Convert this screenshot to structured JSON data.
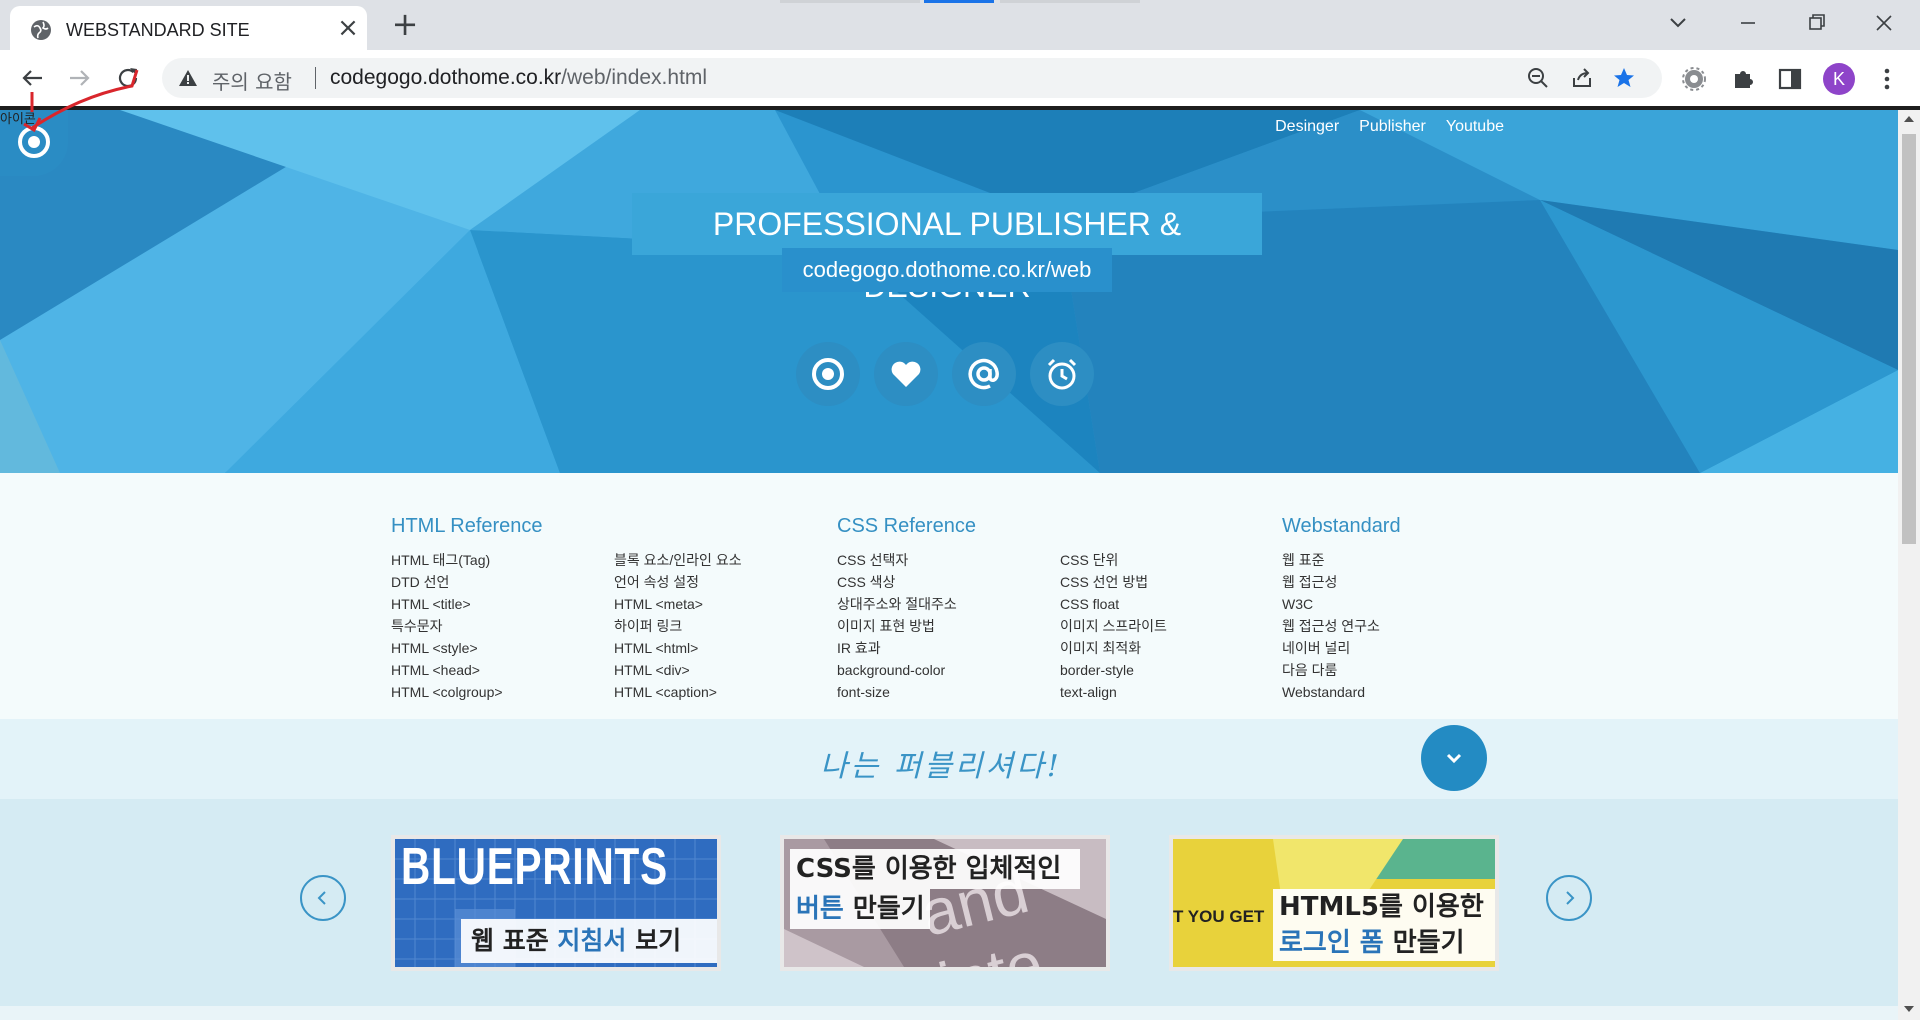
{
  "browser": {
    "tab_title": "WEBSTANDARD SITE",
    "security_warning": "주의 요함",
    "url_host": "codegogo.dothome.co.kr",
    "url_path": "/web/index.html",
    "profile_initial": "K"
  },
  "page": {
    "corner_label": "아이콘",
    "top_nav": [
      "Desinger",
      "Publisher",
      "Youtube"
    ],
    "headline": "PROFESSIONAL PUBLISHER & DESIGNER",
    "subheadline": "codegogo.dothome.co.kr/web",
    "hero_icons": [
      "target-icon",
      "heart-icon",
      "at-icon",
      "alarm-icon"
    ],
    "refs": [
      {
        "title": "HTML Reference",
        "col1": [
          "HTML 태그(Tag)",
          "DTD 선언",
          "HTML <title>",
          "특수문자",
          "HTML <style>",
          "HTML <head>",
          "HTML <colgroup>"
        ],
        "col2": [
          "블록 요소/인라인 요소",
          "언어 속성 설정",
          "HTML <meta>",
          "하이퍼 링크",
          "HTML <html>",
          "HTML <div>",
          "HTML <caption>"
        ]
      },
      {
        "title": "CSS Reference",
        "col1": [
          "CSS 선택자",
          "CSS 색상",
          "상대주소와 절대주소",
          "이미지 표현 방법",
          "IR 효과",
          "background-color",
          "font-size"
        ],
        "col2": [
          "CSS 단위",
          "CSS 선언 방법",
          "CSS float",
          "이미지 스프라이트",
          "이미지 최적화",
          "border-style",
          "text-align"
        ]
      },
      {
        "title": "Webstandard",
        "col1": [
          "웹 표준",
          "웹 접근성",
          "W3C",
          "웹 접근성 연구소",
          "네이버 널리",
          "다음 다룸",
          "Webstandard"
        ]
      }
    ],
    "slogan": "나는 퍼블리셔다!",
    "cards": [
      {
        "big": "BLUEPRINTS",
        "line1": "웹 표준 ",
        "line1_hl": "지침서",
        "line1_end": " 보기"
      },
      {
        "line1": "CSS를 이용한 입체적인",
        "line2_hl": "버튼",
        "line2_end": " 만들기",
        "bg_text": "and inte"
      },
      {
        "side": "T YOU GET",
        "line1": "HTML5를 이용한",
        "line2_hl": "로그인 폼",
        "line2_end": " 만들기"
      }
    ],
    "colors": {
      "accent": "#2b95cf",
      "link": "#3590c3",
      "band": "#e3f3f9"
    }
  }
}
